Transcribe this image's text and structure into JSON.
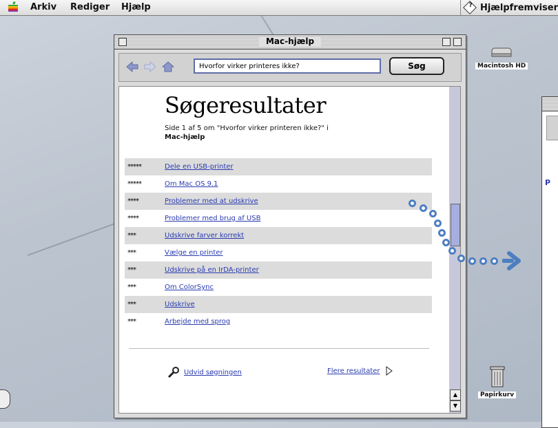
{
  "menubar": {
    "items": [
      "Arkiv",
      "Rediger",
      "Hjælp"
    ],
    "helper": "Hjælpfremviser"
  },
  "window": {
    "title": "Mac-hjælp",
    "search_value": "Hvorfor virker printeres ikke?",
    "search_button": "Søg",
    "heading": "Søgeresultater",
    "subtitle_line1": "Side 1 af 5 om \"Hvorfor virker printeren ikke?\" i",
    "subtitle_line2": "Mac-hjælp",
    "results": [
      {
        "stars": "*****",
        "label": "Dele en USB-printer"
      },
      {
        "stars": "*****",
        "label": "Om Mac OS 9.1"
      },
      {
        "stars": "****",
        "label": "Problemer med at udskrive"
      },
      {
        "stars": "****",
        "label": "Problemer med brug af USB"
      },
      {
        "stars": "***",
        "label": "Udskrive farver korrekt"
      },
      {
        "stars": "***",
        "label": "Vælge en printer"
      },
      {
        "stars": "***",
        "label": "Udskrive på en IrDA-printer"
      },
      {
        "stars": "***",
        "label": "Om ColorSync"
      },
      {
        "stars": "***",
        "label": "Udskrive"
      },
      {
        "stars": "***",
        "label": "Arbejde med sprog"
      }
    ],
    "expand_link": "Udvid søgningen",
    "more_link": "Flere resultater"
  },
  "desktop": {
    "hd_label": "Macintosh HD",
    "trash_label": "Papirkurv",
    "second_window_letter": "P"
  },
  "colors": {
    "link": "#2a3bb0",
    "accent": "#4d7fc0",
    "row_shade": "#dcdcdc"
  }
}
